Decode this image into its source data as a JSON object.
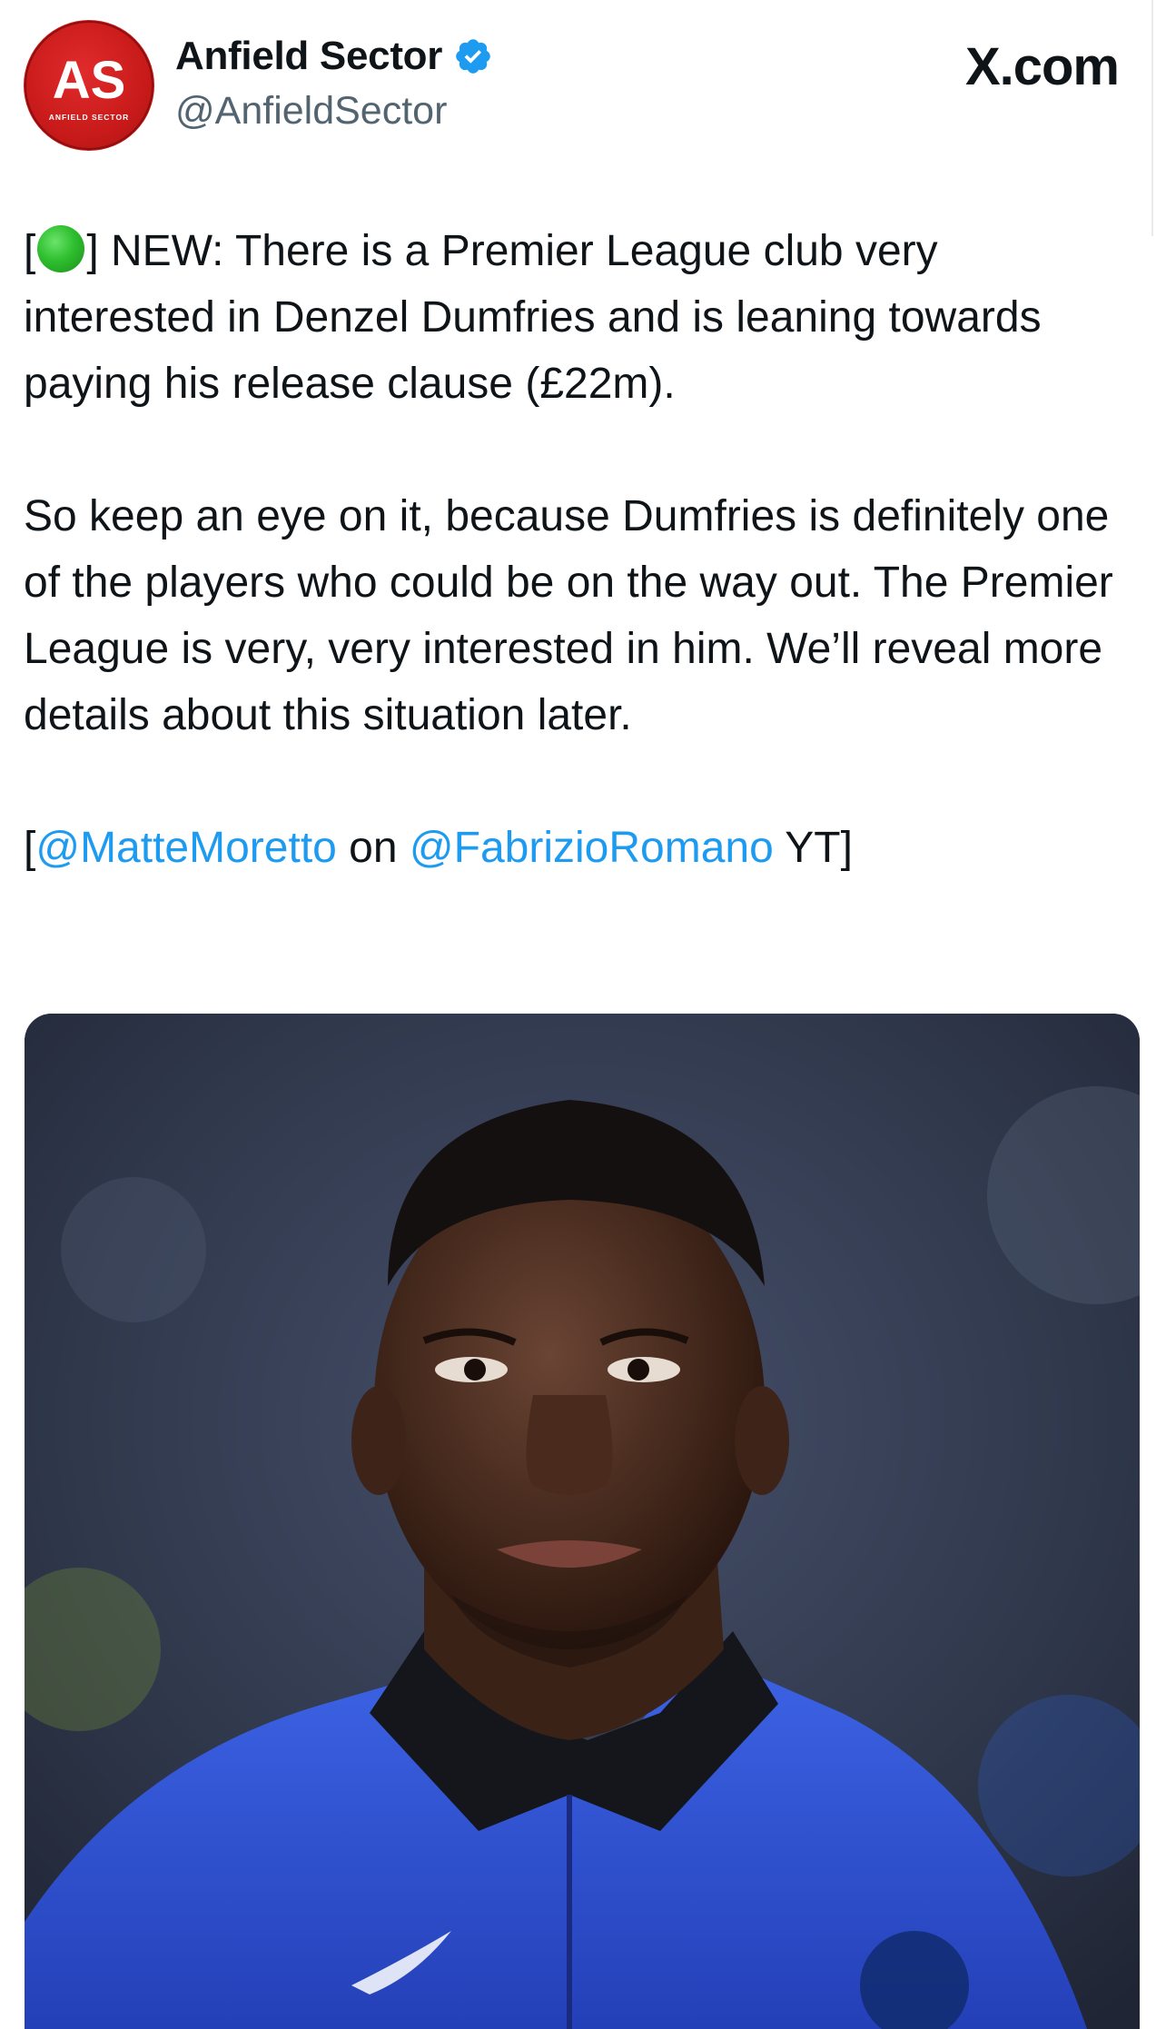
{
  "header": {
    "display_name": "Anfield Sector",
    "handle": "@AnfieldSector",
    "brand": "X.com",
    "avatar_text": "AS",
    "avatar_subtext": "ANFIELD SECTOR"
  },
  "tweet": {
    "line1_open": "[",
    "line1_rest": "] NEW: There is a Premier League club very interested in Denzel Dumfries and is leaning towards paying his release clause (£22m).",
    "paragraph2": "So keep an eye on it, because Dumfries is definitely one of the players who could be on the way out. The Premier League is very, very interested in him. We’ll reveal more details about this situation later.",
    "source_open": "[",
    "mention1": "@MatteMoretto",
    "source_mid": " on ",
    "mention2": "@FabrizioRomano",
    "source_close": " YT]"
  },
  "colors": {
    "accent": "#1d9bf0",
    "avatar_red": "#c81a1a",
    "status_green": "#2fbf2f",
    "jacket_blue": "#2f54d8"
  },
  "icons": {
    "verified": "verified-badge-icon",
    "status": "green-circle-icon"
  }
}
